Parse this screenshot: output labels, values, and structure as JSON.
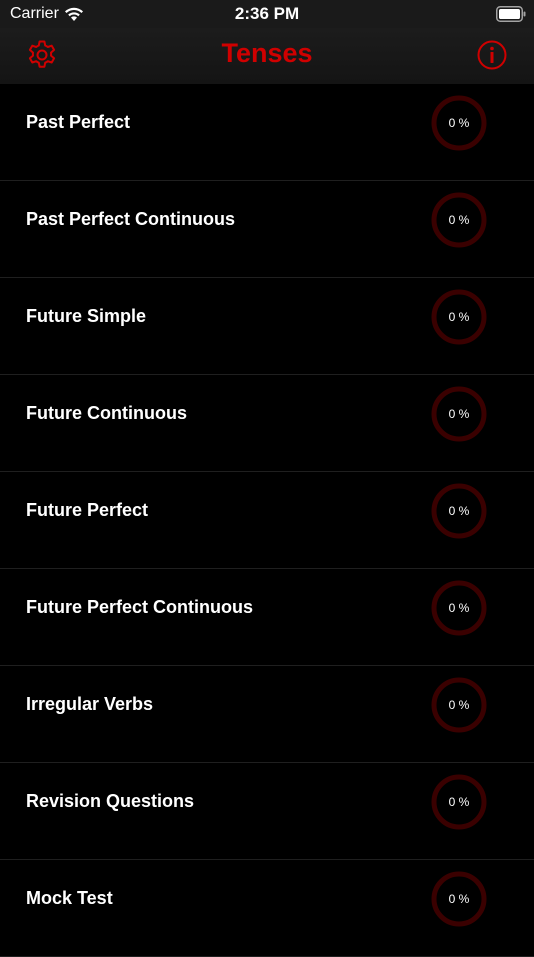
{
  "status_bar": {
    "carrier": "Carrier",
    "time": "2:36 PM"
  },
  "nav": {
    "title": "Tenses",
    "accent_color": "#d00000",
    "left_icon": "gear-icon",
    "right_icon": "info-icon"
  },
  "colors": {
    "background": "#000000",
    "ring_track": "#3a0000",
    "ring_fill": "#d00000"
  },
  "items": [
    {
      "label": "Past Perfect",
      "progress_text": "0 %",
      "progress": 0
    },
    {
      "label": "Past Perfect Continuous",
      "progress_text": "0 %",
      "progress": 0
    },
    {
      "label": "Future Simple",
      "progress_text": "0 %",
      "progress": 0
    },
    {
      "label": "Future Continuous",
      "progress_text": "0 %",
      "progress": 0
    },
    {
      "label": "Future Perfect",
      "progress_text": "0 %",
      "progress": 0
    },
    {
      "label": "Future Perfect Continuous",
      "progress_text": "0 %",
      "progress": 0
    },
    {
      "label": "Irregular Verbs",
      "progress_text": "0 %",
      "progress": 0
    },
    {
      "label": "Revision Questions",
      "progress_text": "0 %",
      "progress": 0
    },
    {
      "label": "Mock Test",
      "progress_text": "0 %",
      "progress": 0
    }
  ]
}
